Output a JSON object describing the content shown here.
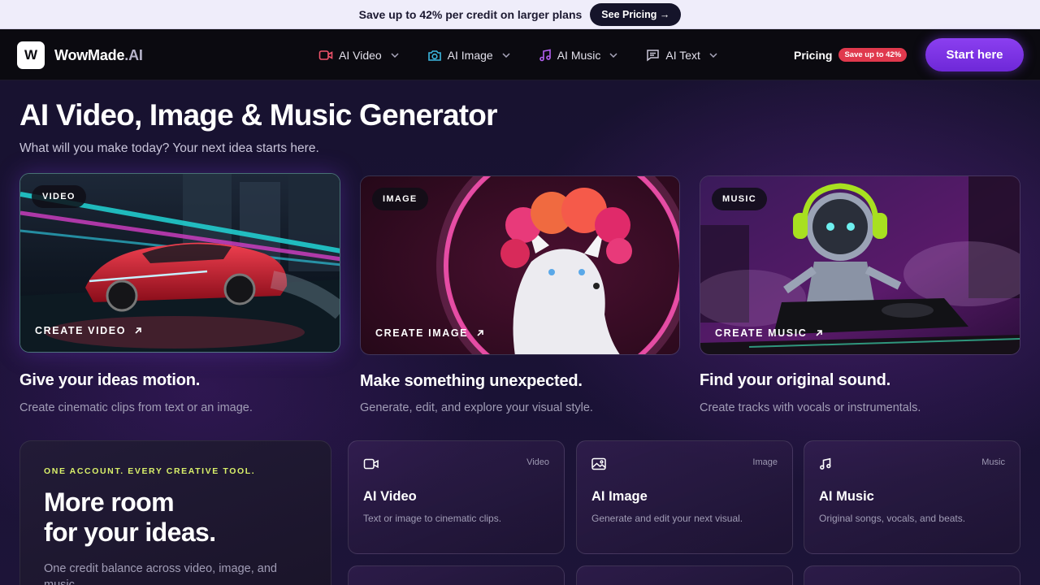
{
  "promo_bar": {
    "text": "Save up to 42% per credit on larger plans",
    "button": "See Pricing →"
  },
  "nav": {
    "logo_letter": "W",
    "brand": "WowMade",
    "brand_tld": ".AI",
    "links": [
      {
        "label": "AI Video",
        "icon": "video-camera-icon"
      },
      {
        "label": "AI Image",
        "icon": "camera-icon"
      },
      {
        "label": "AI Music",
        "icon": "music-note-icon"
      },
      {
        "label": "AI Text",
        "icon": "chat-bubble-icon"
      }
    ],
    "pricing_label": "Pricing",
    "pricing_badge": "Save up to 42%",
    "cta": "Start here"
  },
  "hero": {
    "title": "AI Video, Image & Music Generator",
    "subtitle": "What will you make today? Your next idea starts here."
  },
  "cards": [
    {
      "tag": "VIDEO",
      "cta": "CREATE VIDEO",
      "heading": "Give your ideas motion.",
      "description": "Create cinematic clips from text or an image."
    },
    {
      "tag": "IMAGE",
      "cta": "CREATE IMAGE",
      "heading": "Make something unexpected.",
      "description": "Generate, edit, and explore your visual style."
    },
    {
      "tag": "MUSIC",
      "cta": "CREATE MUSIC",
      "heading": "Find your original sound.",
      "description": "Create tracks with vocals or instrumentals."
    }
  ],
  "promo_box": {
    "kicker": "ONE ACCOUNT. EVERY CREATIVE TOOL.",
    "title_line1": "More room",
    "title_line2": "for your ideas.",
    "description": "One credit balance across video, image, and music."
  },
  "tools": [
    {
      "category": "Video",
      "title": "AI Video",
      "description": "Text or image to cinematic clips.",
      "icon": "video-icon"
    },
    {
      "category": "Image",
      "title": "AI Image",
      "description": "Generate and edit your next visual.",
      "icon": "image-icon"
    },
    {
      "category": "Music",
      "title": "AI Music",
      "description": "Original songs, vocals, and beats.",
      "icon": "music-icon"
    }
  ],
  "colors": {
    "accent": "#7b33e6",
    "badge": "#e0394d",
    "kicker": "#d9f06a"
  }
}
